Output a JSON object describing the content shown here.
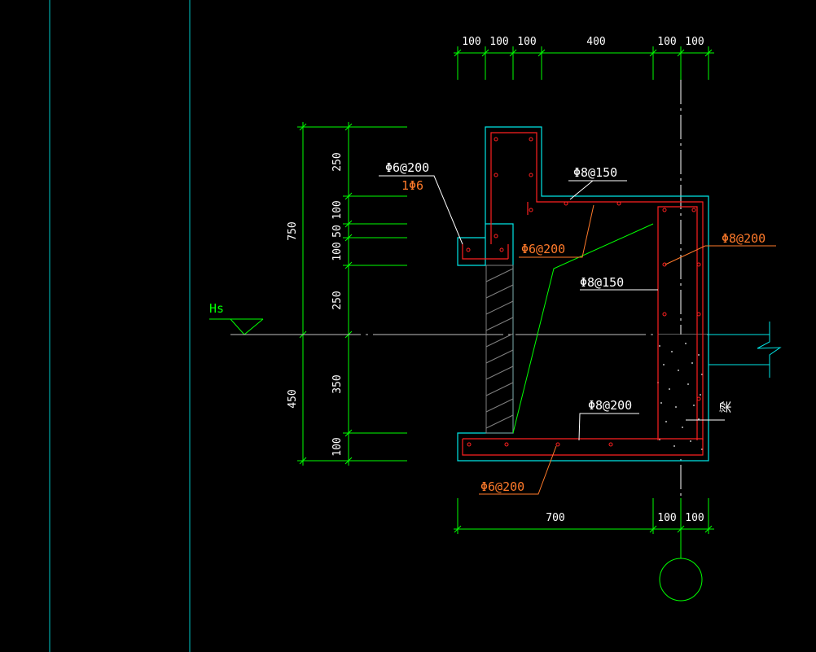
{
  "colors": {
    "background": "#000000",
    "concrete_outline": "#00ffff",
    "rebar": "#ff2020",
    "dimension": "#00ff00",
    "text_white": "#ffffff",
    "text_orange": "#ff7a2a",
    "hatch": "#808080",
    "ref_line": "#bfbfbf"
  },
  "dimensions": {
    "top": [
      "100",
      "100",
      "100",
      "400",
      "100",
      "100"
    ],
    "bottom": [
      "700",
      "100",
      "100"
    ],
    "left_inner": [
      "250",
      "100",
      "50",
      "100",
      "250",
      "350",
      "100"
    ],
    "left_outer": [
      "750",
      "450"
    ]
  },
  "labels": {
    "water_level": "Hs",
    "rebar_a_top": "Φ6@200",
    "rebar_a_bottom": "1Φ6",
    "rebar_b": "Φ8@150",
    "rebar_c": "Φ6@200",
    "rebar_d": "Φ8@200",
    "rebar_e": "Φ8@150",
    "rebar_f": "Φ8@200",
    "rebar_g": "Φ6@200",
    "beam": "梁"
  }
}
